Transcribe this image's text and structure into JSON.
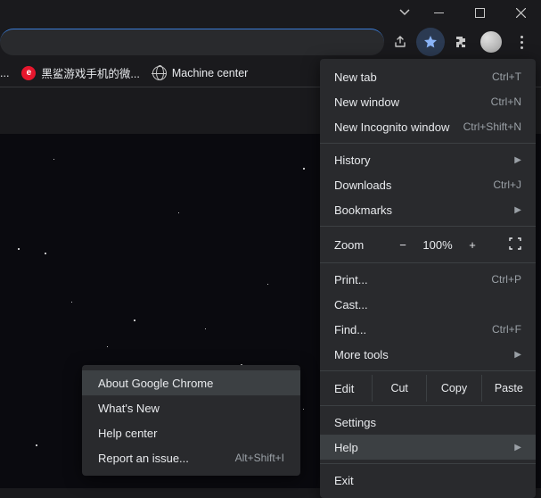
{
  "bookmarks": [
    {
      "label": "...",
      "icon": "ellipsis"
    },
    {
      "label": "黑鲨游戏手机的微...",
      "icon": "weibo"
    },
    {
      "label": "Machine center",
      "icon": "globe"
    }
  ],
  "main_menu": {
    "new_tab": {
      "label": "New tab",
      "shortcut": "Ctrl+T"
    },
    "new_window": {
      "label": "New window",
      "shortcut": "Ctrl+N"
    },
    "new_incognito": {
      "label": "New Incognito window",
      "shortcut": "Ctrl+Shift+N"
    },
    "history": {
      "label": "History"
    },
    "downloads": {
      "label": "Downloads",
      "shortcut": "Ctrl+J"
    },
    "bookmarks": {
      "label": "Bookmarks"
    },
    "zoom": {
      "label": "Zoom",
      "minus": "−",
      "value": "100%",
      "plus": "+"
    },
    "print": {
      "label": "Print...",
      "shortcut": "Ctrl+P"
    },
    "cast": {
      "label": "Cast..."
    },
    "find": {
      "label": "Find...",
      "shortcut": "Ctrl+F"
    },
    "more_tools": {
      "label": "More tools"
    },
    "edit": {
      "label": "Edit",
      "cut": "Cut",
      "copy": "Copy",
      "paste": "Paste"
    },
    "settings": {
      "label": "Settings"
    },
    "help": {
      "label": "Help"
    },
    "exit": {
      "label": "Exit"
    }
  },
  "help_menu": {
    "about": {
      "label": "About Google Chrome"
    },
    "whats_new": {
      "label": "What's New"
    },
    "help_center": {
      "label": "Help center"
    },
    "report": {
      "label": "Report an issue...",
      "shortcut": "Alt+Shift+I"
    }
  }
}
